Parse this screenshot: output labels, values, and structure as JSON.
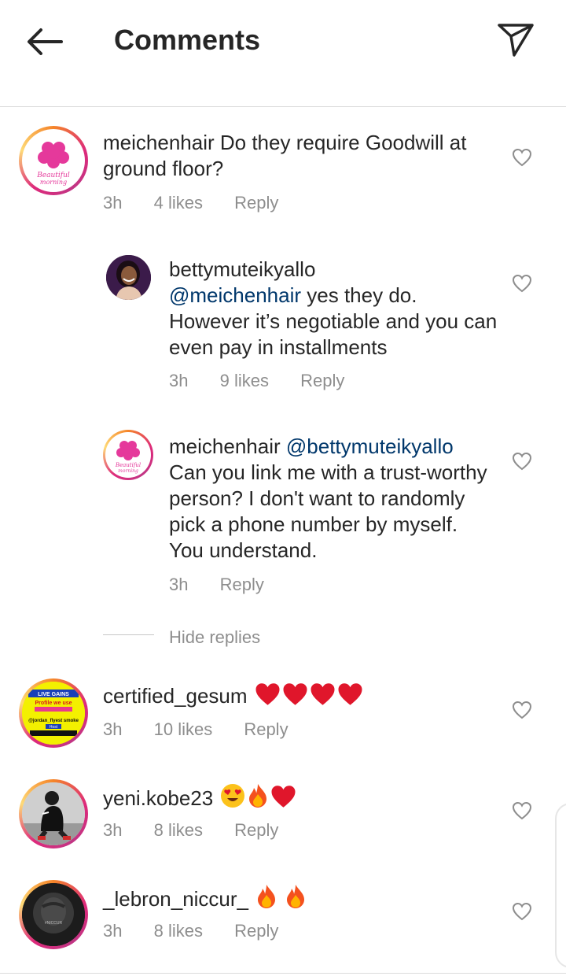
{
  "header": {
    "title": "Comments"
  },
  "comments": [
    {
      "username": "meichenhair",
      "text": "Do they require Goodwill at ground floor?",
      "time": "3h",
      "likes": "4 likes",
      "reply": "Reply"
    },
    {
      "username": "bettymuteikyallo",
      "mention": "@meichenhair",
      "text": "yes they do. However it’s negotiable and you can even pay in installments",
      "time": "3h",
      "likes": "9 likes",
      "reply": "Reply"
    },
    {
      "username": "meichenhair",
      "mention": "@bettymuteikyallo",
      "text": "Can you link me with a trust-worthy person? I don't want to randomly pick a phone number by myself. You understand.",
      "time": "3h",
      "reply": "Reply"
    },
    {
      "username": "certified_gesum",
      "time": "3h",
      "likes": "10 likes",
      "reply": "Reply"
    },
    {
      "username": "yeni.kobe23",
      "time": "3h",
      "likes": "8 likes",
      "reply": "Reply"
    },
    {
      "username": "_lebron_niccur_",
      "time": "3h",
      "likes": "8 likes",
      "reply": "Reply"
    }
  ],
  "thread": {
    "hide_replies": "Hide replies"
  },
  "avatars": {
    "beautiful_text_1": "Beautiful",
    "beautiful_text_2": "morning",
    "gesum_line1": "LIVE GAINS",
    "gesum_line2": "Profile we use",
    "gesum_line3": "@jordan_flyest smoke",
    "gesum_line4": "Host",
    "lebron_tag": "#NICCUR"
  },
  "icons": {
    "back": "back-arrow-icon",
    "send": "send-icon",
    "heart": "heart-outline-icon",
    "emoji_heart": "red-heart-emoji",
    "emoji_fire": "fire-emoji",
    "emoji_heart_eyes": "heart-eyes-emoji"
  },
  "colors": {
    "mention": "#00376b",
    "meta": "#8e8e8e",
    "text": "#262626",
    "divider": "#dbdbdb"
  }
}
